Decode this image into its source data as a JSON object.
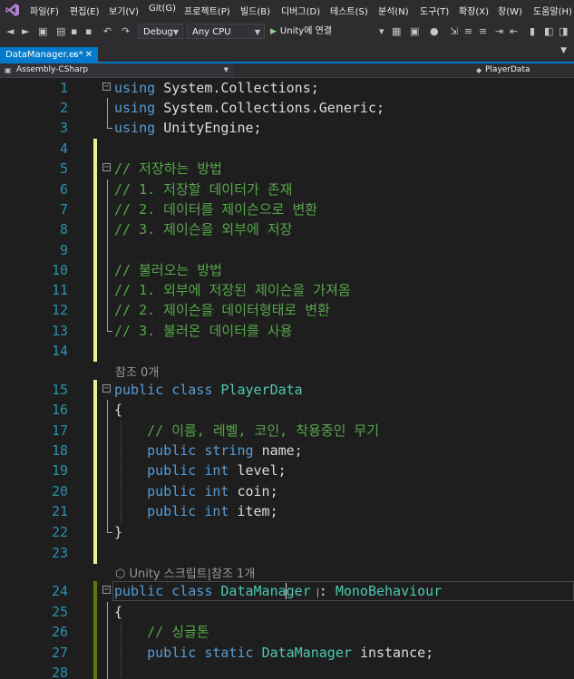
{
  "menubar": {
    "items": [
      "파일(F)",
      "편집(E)",
      "보기(V)",
      "Git(G)",
      "프로젝트(P)",
      "빌드(B)",
      "디버그(D)",
      "테스트(S)",
      "분석(N)",
      "도구(T)",
      "확장(X)",
      "창(W)",
      "도움말(H)"
    ]
  },
  "toolbar": {
    "configuration": "Debug",
    "platform": "Any CPU",
    "run_label": "Unity에 연결"
  },
  "tab": {
    "title": "DataManager.cs*",
    "pin_icon": "pin-icon",
    "close_icon": "close-icon"
  },
  "navbar": {
    "project": "Assembly-CSharp",
    "member": "PlayerData"
  },
  "codelens": {
    "ref0": "참조 0개",
    "unity_ref": "Unity 스크립트|참조 1개"
  },
  "code_lines": [
    {
      "n": "1",
      "parts": [
        [
          "kw",
          "using "
        ],
        [
          "pl",
          "System.Collections;"
        ]
      ]
    },
    {
      "n": "2",
      "parts": [
        [
          "kw",
          "using "
        ],
        [
          "pl",
          "System.Collections.Generic;"
        ]
      ]
    },
    {
      "n": "3",
      "parts": [
        [
          "kw",
          "using "
        ],
        [
          "pl",
          "UnityEngine;"
        ]
      ]
    },
    {
      "n": "4",
      "parts": []
    },
    {
      "n": "5",
      "parts": [
        [
          "cm",
          "// 저장하는 방법"
        ]
      ]
    },
    {
      "n": "6",
      "parts": [
        [
          "cm",
          "// 1. 저장할 데이터가 존재"
        ]
      ]
    },
    {
      "n": "7",
      "parts": [
        [
          "cm",
          "// 2. 데이터를 제이슨으로 변환"
        ]
      ]
    },
    {
      "n": "8",
      "parts": [
        [
          "cm",
          "// 3. 제이슨을 외부에 저장"
        ]
      ]
    },
    {
      "n": "9",
      "parts": []
    },
    {
      "n": "10",
      "parts": [
        [
          "cm",
          "// 불러오는 방법"
        ]
      ]
    },
    {
      "n": "11",
      "parts": [
        [
          "cm",
          "// 1. 외부에 저장된 제이슨을 가져옴"
        ]
      ]
    },
    {
      "n": "12",
      "parts": [
        [
          "cm",
          "// 2. 제이슨을 데이터형태로 변환"
        ]
      ]
    },
    {
      "n": "13",
      "parts": [
        [
          "cm",
          "// 3. 불러온 데이터를 사용"
        ]
      ]
    },
    {
      "n": "14",
      "parts": []
    },
    {
      "n": "15",
      "parts": [
        [
          "kw",
          "public "
        ],
        [
          "kw",
          "class "
        ],
        [
          "ty",
          "PlayerData"
        ]
      ]
    },
    {
      "n": "16",
      "parts": [
        [
          "pl",
          "{"
        ]
      ]
    },
    {
      "n": "17",
      "parts": [
        [
          "pl",
          "    "
        ],
        [
          "cm",
          "// 이름, 레벨, 코인, 착용중인 무기"
        ]
      ]
    },
    {
      "n": "18",
      "parts": [
        [
          "pl",
          "    "
        ],
        [
          "kw",
          "public "
        ],
        [
          "kw",
          "string "
        ],
        [
          "pl",
          "name;"
        ]
      ]
    },
    {
      "n": "19",
      "parts": [
        [
          "pl",
          "    "
        ],
        [
          "kw",
          "public "
        ],
        [
          "kw",
          "int "
        ],
        [
          "pl",
          "level;"
        ]
      ]
    },
    {
      "n": "20",
      "parts": [
        [
          "pl",
          "    "
        ],
        [
          "kw",
          "public "
        ],
        [
          "kw",
          "int "
        ],
        [
          "pl",
          "coin;"
        ]
      ]
    },
    {
      "n": "21",
      "parts": [
        [
          "pl",
          "    "
        ],
        [
          "kw",
          "public "
        ],
        [
          "kw",
          "int "
        ],
        [
          "pl",
          "item;"
        ]
      ]
    },
    {
      "n": "22",
      "parts": [
        [
          "pl",
          "}"
        ]
      ]
    },
    {
      "n": "23",
      "parts": []
    },
    {
      "n": "24",
      "parts": [
        [
          "kw",
          "public "
        ],
        [
          "kw",
          "class "
        ],
        [
          "ty",
          "DataManager "
        ],
        [
          "pl",
          ": "
        ],
        [
          "ty",
          "MonoBehaviour"
        ]
      ]
    },
    {
      "n": "25",
      "parts": [
        [
          "pl",
          "{"
        ]
      ]
    },
    {
      "n": "26",
      "parts": [
        [
          "pl",
          "    "
        ],
        [
          "cm",
          "// 싱글톤"
        ]
      ]
    },
    {
      "n": "27",
      "parts": [
        [
          "pl",
          "    "
        ],
        [
          "kw",
          "public "
        ],
        [
          "kw",
          "static "
        ],
        [
          "ty",
          "DataManager "
        ],
        [
          "pl",
          "instance;"
        ]
      ]
    },
    {
      "n": "28",
      "parts": []
    }
  ]
}
